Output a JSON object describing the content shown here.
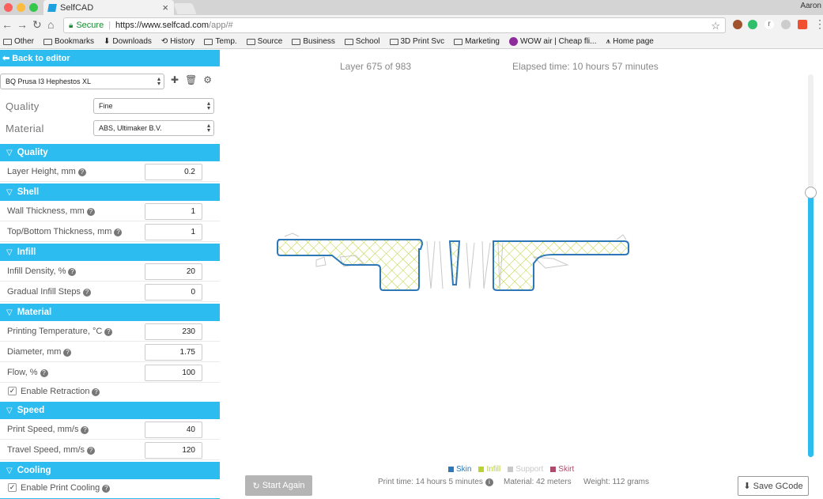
{
  "browser": {
    "tab_title": "SelfCAD",
    "tab_close": "×",
    "profile": "Aaron",
    "secure_label": "Secure",
    "url_main": "https://www.selfcad.com",
    "url_rest": "/app/#",
    "bookmarks": [
      "Other",
      "Bookmarks",
      "Downloads",
      "History",
      "Temp.",
      "Source",
      "Business",
      "School",
      "3D Print Svc",
      "Marketing",
      "WOW air | Cheap fli...",
      "Home page"
    ]
  },
  "sidebar": {
    "back_label": "Back to editor",
    "printer": "BQ Prusa I3 Hephestos XL",
    "quality_label": "Quality",
    "quality_value": "Fine",
    "material_label": "Material",
    "material_value": "ABS, Ultimaker B.V.",
    "sections": {
      "quality": "Quality",
      "shell": "Shell",
      "infill": "Infill",
      "material": "Material",
      "speed": "Speed",
      "cooling": "Cooling"
    },
    "fields": {
      "layer_height": {
        "label": "Layer Height, mm",
        "value": "0.2"
      },
      "wall_thickness": {
        "label": "Wall Thickness, mm",
        "value": "1"
      },
      "top_bottom": {
        "label": "Top/Bottom Thickness, mm",
        "value": "1"
      },
      "infill_density": {
        "label": "Infill Density, %",
        "value": "20"
      },
      "gradual_infill": {
        "label": "Gradual Infill Steps",
        "value": "0"
      },
      "print_temp": {
        "label": "Printing Temperature, °C",
        "value": "230"
      },
      "diameter": {
        "label": "Diameter, mm",
        "value": "1.75"
      },
      "flow": {
        "label": "Flow, %",
        "value": "100"
      },
      "enable_retraction": {
        "label": "Enable Retraction",
        "checked": true
      },
      "print_speed": {
        "label": "Print Speed, mm/s",
        "value": "40"
      },
      "travel_speed": {
        "label": "Travel Speed, mm/s",
        "value": "120"
      },
      "enable_cooling": {
        "label": "Enable Print Cooling",
        "checked": true
      }
    }
  },
  "viewer": {
    "layer_text": "Layer 675 of 983",
    "elapsed_text": "Elapsed time: 10 hours 57 minutes",
    "layer_fraction": 0.686,
    "legend": [
      {
        "label": "Skin",
        "color": "#2f78b7"
      },
      {
        "label": "Infill",
        "color": "#b7d334"
      },
      {
        "label": "Support",
        "color": "#c8c8c8"
      },
      {
        "label": "Skirt",
        "color": "#b04a6a"
      }
    ],
    "start_again": "Start Again",
    "print_time": "Print time: 14 hours 5 minutes",
    "material_stat": "Material: 42 meters",
    "weight_stat": "Weight: 112 grams",
    "save_gcode": "Save GCode"
  },
  "colors": {
    "accent": "#2dbcf0",
    "skin": "#2f78b7",
    "infill": "#b7d334"
  }
}
